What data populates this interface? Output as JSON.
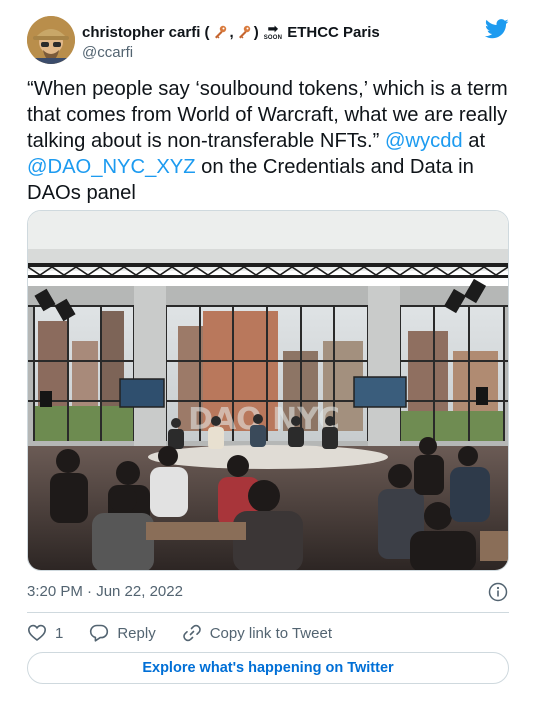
{
  "author": {
    "display_name": "christopher carfi (",
    "name_separator": ",",
    "name_after_keys": ")",
    "soon_label": "SOON",
    "event_label": "ETHCC Paris",
    "handle": "@ccarfi"
  },
  "tweet": {
    "text_main": "“When people say ‘soulbound tokens,’ which is a term that comes from World of Warcraft, what we are really talking about is non-transferable NFTs.”",
    "mention_1": "@wycdd",
    "connector": " at ",
    "mention_2": "@DAO_NYC_XYZ",
    "text_end": " on the Credentials and Data in DAOs panel",
    "image_text": "DAO NYC"
  },
  "meta": {
    "timestamp": "3:20 PM · Jun 22, 2022"
  },
  "actions": {
    "like_count": "1",
    "reply_label": "Reply",
    "copy_label": "Copy link to Tweet"
  },
  "footer": {
    "explore_label": "Explore what's happening on Twitter"
  },
  "colors": {
    "twitter_blue": "#1d9bf0",
    "link_blue": "#006fd6",
    "text": "#0f1419",
    "secondary": "#536471",
    "border": "#cfd9de"
  },
  "icons": [
    "avatar",
    "key-icon",
    "soon-arrow-icon",
    "twitter-bird-icon",
    "info-icon",
    "heart-icon",
    "reply-icon",
    "link-icon"
  ]
}
